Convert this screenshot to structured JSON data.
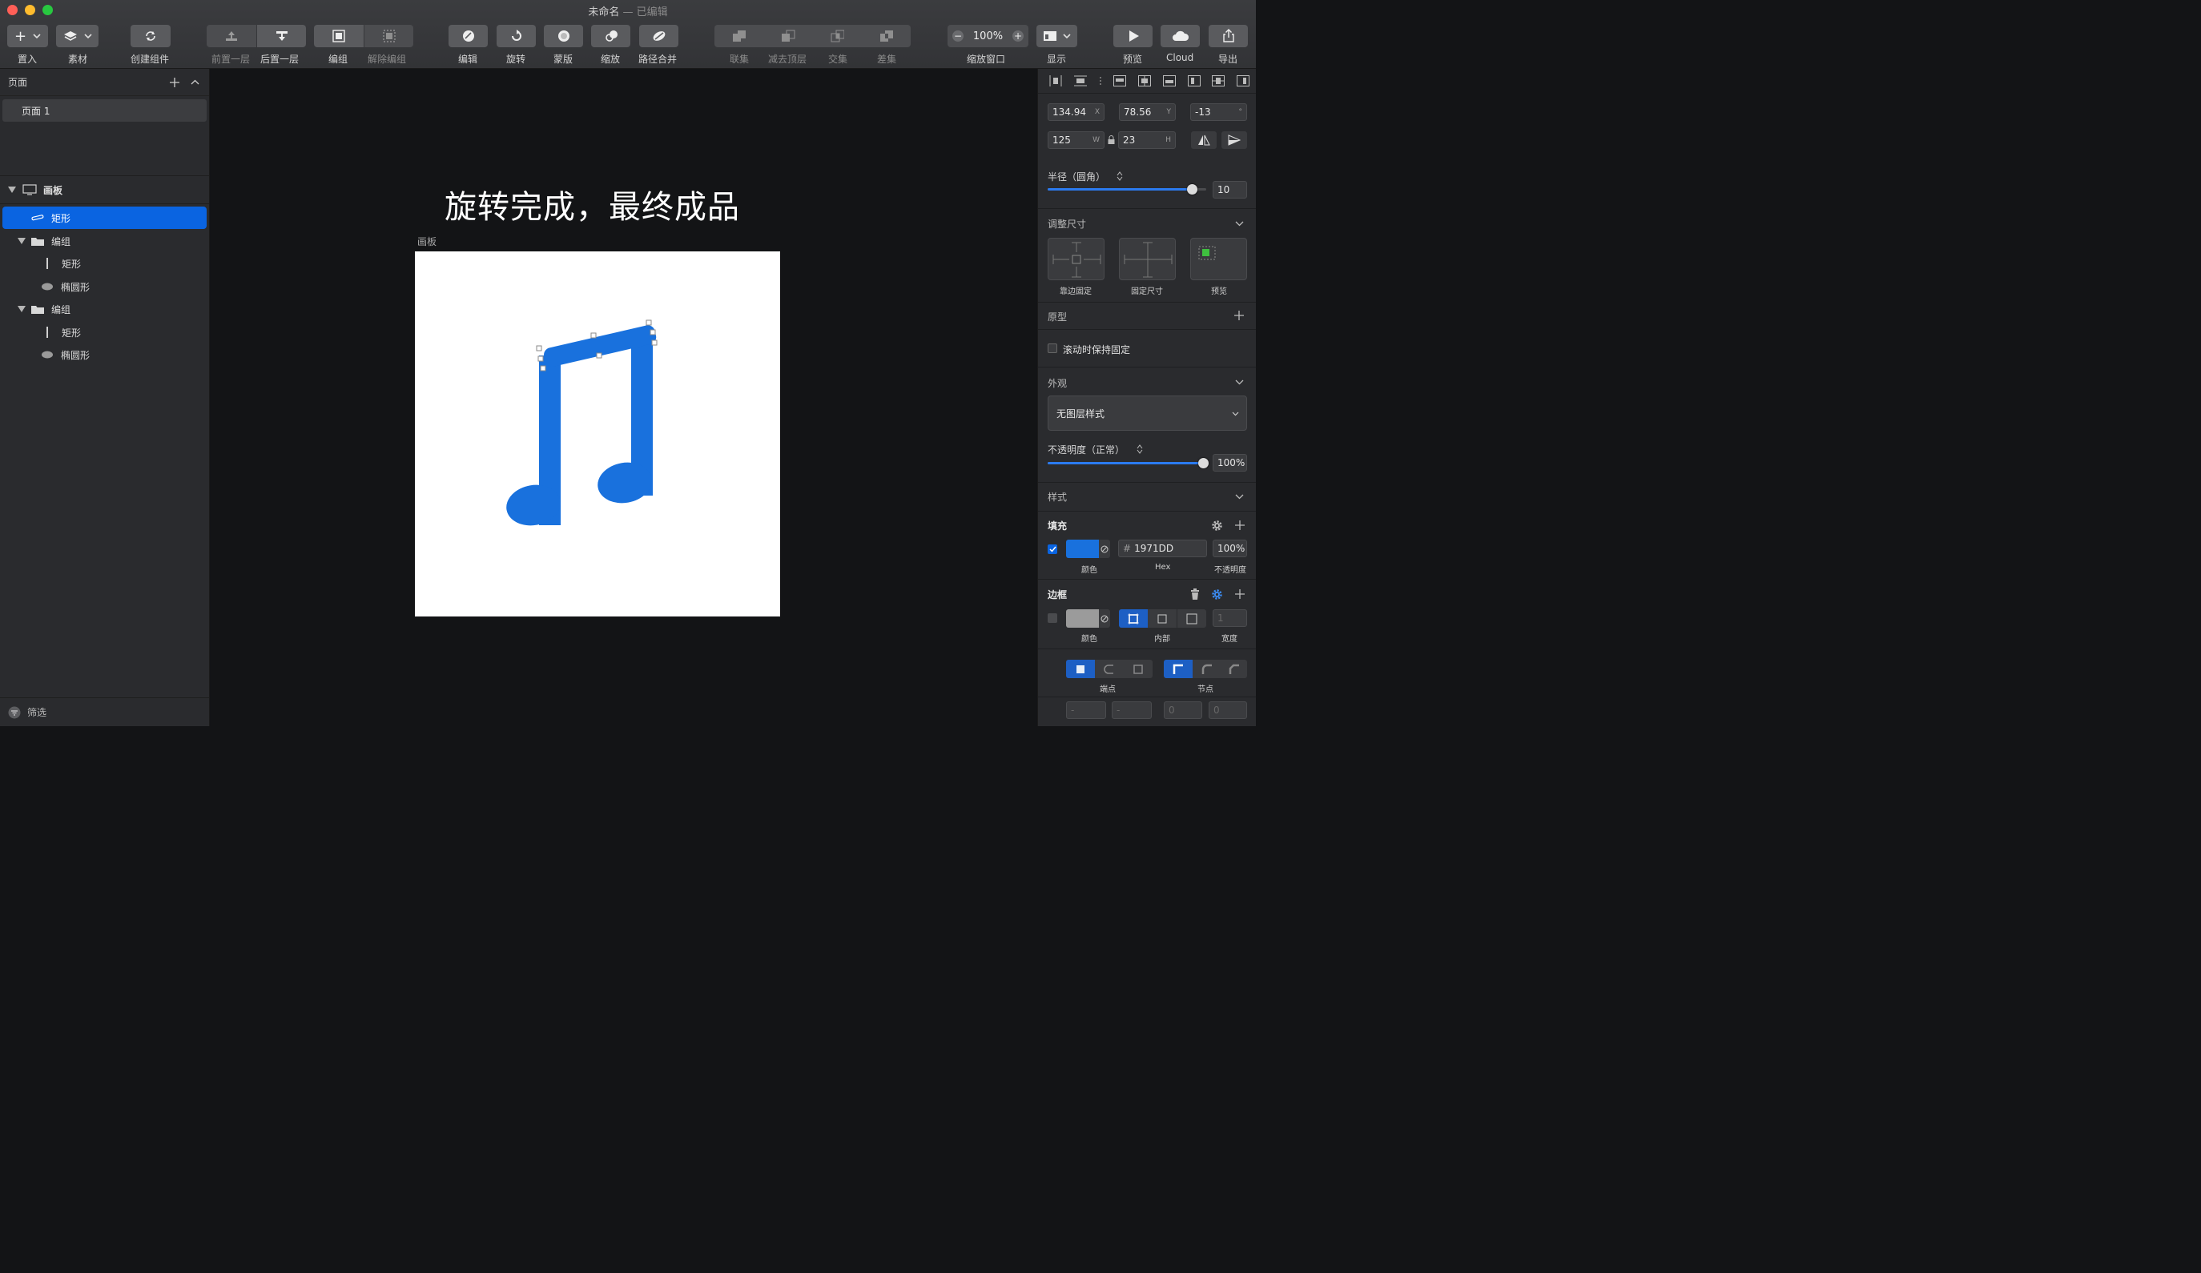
{
  "window": {
    "title": "未命名",
    "sep": " — ",
    "status": "已编辑"
  },
  "colors": {
    "accent": "#0a64e1",
    "fill": "#1971DD",
    "close": "#ff5f57",
    "min": "#febc2e",
    "max": "#28c840"
  },
  "toolbar": {
    "insert": "置入",
    "assets": "素材",
    "create_component": "创建组件",
    "forward": "前置一层",
    "backward": "后置一层",
    "group": "编组",
    "ungroup": "解除编组",
    "edit": "编辑",
    "rotate": "旋转",
    "mask": "蒙版",
    "scale": "缩放",
    "flatten": "路径合并",
    "union": "联集",
    "subtract": "减去顶层",
    "intersect": "交集",
    "difference": "差集",
    "zoom_value": "100%",
    "zoom": "缩放窗口",
    "view": "显示",
    "preview": "预览",
    "cloud": "Cloud",
    "export": "导出"
  },
  "pages": {
    "header": "页面",
    "items": [
      "页面 1"
    ]
  },
  "layers": {
    "artboard": "画板",
    "items": [
      "矩形",
      "编组",
      "矩形",
      "椭圆形",
      "编组",
      "矩形",
      "椭圆形"
    ]
  },
  "filter": "筛选",
  "canvas": {
    "heading": "旋转完成，最终成品",
    "artboard_label": "画板"
  },
  "inspector": {
    "x": "134.94",
    "x_sfx": "X",
    "y": "78.56",
    "y_sfx": "Y",
    "rot": "-13",
    "rot_sfx": "°",
    "w": "125",
    "w_sfx": "W",
    "h": "23",
    "h_sfx": "H",
    "radius_label": "半径（圆角）",
    "radius_value": "10",
    "resizing": "调整尺寸",
    "pin_edge": "靠边固定",
    "fix_size": "固定尺寸",
    "preview": "预览",
    "prototype": "原型",
    "fix_scroll": "滚动时保持固定",
    "appearance": "外观",
    "layer_style": "无图层样式",
    "opacity_label": "不透明度（正常）",
    "opacity_value": "100%",
    "style": "样式",
    "fill_header": "填充",
    "fill_hex_prefix": "#",
    "fill_hex": "1971DD",
    "fill_opacity": "100%",
    "color": "颜色",
    "hex": "Hex",
    "opacity": "不透明度",
    "border_header": "边框",
    "border_color": "颜色",
    "border_pos": "内部",
    "border_width_label": "宽度",
    "border_width": "1",
    "ends": "端点",
    "joins": "节点",
    "dash": "-",
    "gap": "-",
    "zero1": "0",
    "zero2": "0"
  }
}
